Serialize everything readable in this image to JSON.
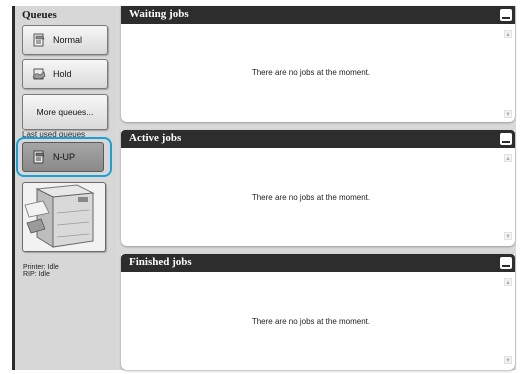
{
  "sidebar": {
    "title": "Queues",
    "queues": [
      {
        "label": "Normal",
        "icon": "queue-icon"
      },
      {
        "label": "Hold",
        "icon": "hold-queue-icon"
      }
    ],
    "more_label": "More queues...",
    "last_used_label": "Last used queues",
    "last_used_queue": {
      "label": "N-UP",
      "icon": "queue-icon"
    },
    "printer_icon": "printer-icon",
    "printer_status": "Printer: Idle",
    "rip_status": "RIP: Idle"
  },
  "panels": {
    "waiting": {
      "title": "Waiting jobs",
      "empty": "There are no jobs at the moment."
    },
    "active": {
      "title": "Active jobs",
      "empty": "There are no jobs at the moment."
    },
    "finished": {
      "title": "Finished jobs",
      "empty": "There are no jobs at the moment."
    }
  },
  "colors": {
    "header": "#2d2d2d",
    "selection_ring": "#1aa0d8",
    "sidebar_bg": "#d7d7d7"
  }
}
